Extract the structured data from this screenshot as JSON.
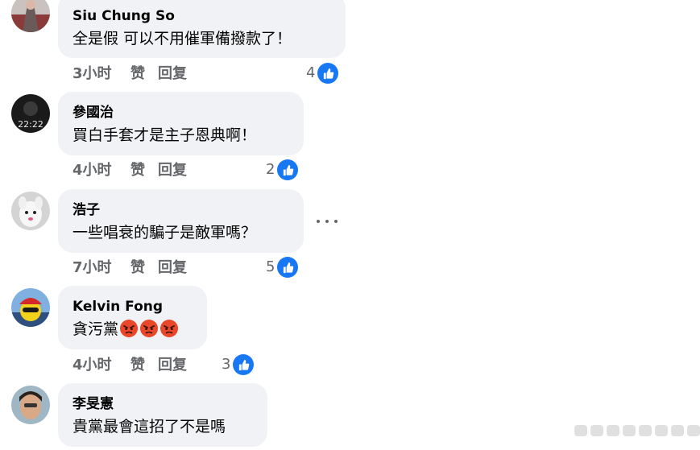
{
  "comments": [
    {
      "author": "Siu Chung So",
      "text": "全是假 可以不用催軍備撥款了！",
      "time": "3小时",
      "like_label": "赞",
      "reply_label": "回复",
      "reactions": "4"
    },
    {
      "author": "參國治",
      "text": "買白手套才是主子恩典啊！",
      "time": "4小时",
      "like_label": "赞",
      "reply_label": "回复",
      "reactions": "2"
    },
    {
      "author": "浩子",
      "text": "一些唱衰的騙子是敵軍嗎？",
      "time": "7小时",
      "like_label": "赞",
      "reply_label": "回复",
      "reactions": "5"
    },
    {
      "author": "Kelvin Fong",
      "text": "貪污黨",
      "emoji": "angry-face-icon x3",
      "time": "4小时",
      "like_label": "赞",
      "reply_label": "回复",
      "reactions": "3"
    },
    {
      "author": "李旻憲",
      "text": "貴黨最會這招了不是嗎"
    }
  ],
  "avatar_labels": {
    "comment_2": "22:22"
  },
  "colors": {
    "like_blue": "#1877f2",
    "bubble": "#f0f2f5",
    "meta_gray": "#65676b",
    "angry_red": "#e8472a"
  }
}
